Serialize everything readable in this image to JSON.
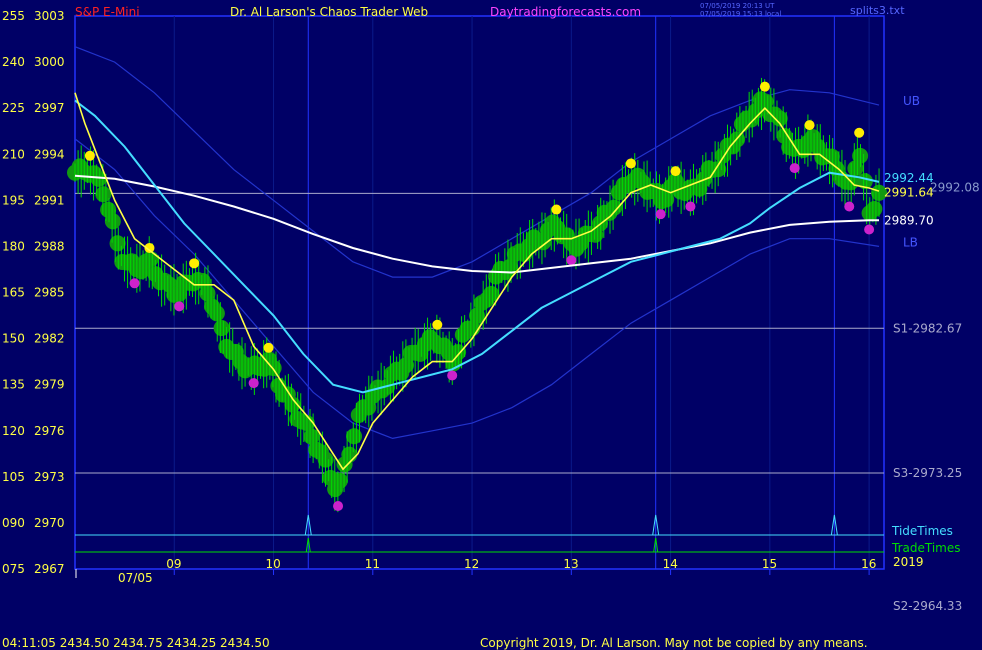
{
  "header": {
    "product": "S&P E-Mini",
    "title": "Dr. Al Larson's Chaos Trader Web",
    "site": "Daytradingforecasts.com",
    "timestamp_ut": "07/05/2019 20:13 UT",
    "timestamp_local": "07/05/2019 15:13 local",
    "data_file": "splits3.txt"
  },
  "footer": {
    "quote": "04:11:05  2434.50  2434.75  2434.25  2434.50",
    "copyright": "Copyright 2019, Dr. Al Larson. May not be copied by any means."
  },
  "colors": {
    "background": "#000066",
    "frame": "#2233ff",
    "price": "#00dd00",
    "fast_avg": "#ffff44",
    "medium_avg": "#44ddff",
    "slow_avg": "#ffffff",
    "band": "#2233cc",
    "high_marker": "#ffee00",
    "low_marker": "#cc22cc",
    "glow": "#119911",
    "level_line": "#aaaacc",
    "tide": "#44ddff",
    "trade": "#00dd00"
  },
  "chart_data": {
    "type": "line",
    "title": "S&P E-Mini",
    "date_label": "07/05",
    "year_label": "2019",
    "x_ticks": [
      "09",
      "10",
      "11",
      "12",
      "13",
      "14",
      "15",
      "16"
    ],
    "x_range_hours": [
      8.0,
      16.15
    ],
    "y_range": [
      2967,
      3003
    ],
    "y_ticks_price": [
      "3003",
      "3000",
      "2997",
      "2994",
      "2991",
      "2988",
      "2985",
      "2982",
      "2979",
      "2976",
      "2973",
      "2970",
      "2967"
    ],
    "y_ticks_scale": [
      "255",
      "240",
      "225",
      "210",
      "195",
      "180",
      "165",
      "150",
      "135",
      "120",
      "105",
      "090",
      "075"
    ],
    "levels": [
      {
        "label": "S1-2982.67",
        "value": 2982.67
      },
      {
        "label": "S3-2973.25",
        "value": 2973.25
      },
      {
        "label": "",
        "value": 2991.45
      }
    ],
    "offscale_level": "S2-2964.33",
    "band_labels": {
      "upper": "UB",
      "lower": "LB"
    },
    "end_values": [
      {
        "label": "2992.44",
        "value": 2992.44,
        "series": "medium_avg"
      },
      {
        "label": "2992.08",
        "value": 2992.08,
        "series": "medium_avg"
      },
      {
        "label": "2991.64",
        "value": 2991.64,
        "series": "fast_avg"
      },
      {
        "label": "2989.70",
        "value": 2989.7,
        "series": "slow_avg"
      }
    ],
    "timing_lines": {
      "labels": [
        "TideTimes",
        "TradeTimes"
      ],
      "hours": [
        10.35,
        13.85,
        15.65
      ]
    },
    "series": [
      {
        "name": "price",
        "x": [
          8.0,
          8.15,
          8.3,
          8.45,
          8.6,
          8.75,
          8.9,
          9.05,
          9.2,
          9.35,
          9.5,
          9.65,
          9.8,
          9.95,
          10.1,
          10.25,
          10.4,
          10.55,
          10.65,
          10.75,
          10.9,
          11.05,
          11.2,
          11.35,
          11.5,
          11.65,
          11.8,
          11.95,
          12.1,
          12.25,
          12.4,
          12.55,
          12.7,
          12.85,
          13.0,
          13.15,
          13.3,
          13.45,
          13.6,
          13.75,
          13.9,
          14.05,
          14.2,
          14.35,
          14.5,
          14.65,
          14.8,
          14.95,
          15.1,
          15.25,
          15.4,
          15.55,
          15.7,
          15.8,
          15.9,
          16.0,
          16.1
        ],
        "y": [
          2992.8,
          2993.0,
          2991.5,
          2987.5,
          2986.5,
          2987.0,
          2985.5,
          2985.0,
          2986.0,
          2985.0,
          2982.0,
          2980.5,
          2980.0,
          2980.5,
          2978.5,
          2977.0,
          2975.5,
          2973.5,
          2972.0,
          2974.5,
          2977.5,
          2978.5,
          2979.5,
          2980.5,
          2981.5,
          2982.0,
          2980.5,
          2982.5,
          2984.0,
          2986.0,
          2987.0,
          2988.0,
          2988.5,
          2989.5,
          2988.0,
          2988.5,
          2989.5,
          2991.0,
          2992.5,
          2992.0,
          2991.0,
          2992.0,
          2991.5,
          2992.5,
          2993.5,
          2995.0,
          2996.5,
          2997.5,
          2996.0,
          2994.0,
          2995.0,
          2994.0,
          2993.0,
          2991.5,
          2994.5,
          2990.0,
          2991.5
        ]
      },
      {
        "name": "fast_avg",
        "x": [
          8.0,
          8.1,
          8.25,
          8.4,
          8.6,
          8.8,
          9.0,
          9.2,
          9.4,
          9.6,
          9.8,
          10.0,
          10.2,
          10.4,
          10.6,
          10.7,
          10.85,
          11.0,
          11.2,
          11.4,
          11.6,
          11.8,
          12.0,
          12.2,
          12.4,
          12.6,
          12.8,
          13.0,
          13.2,
          13.4,
          13.6,
          13.8,
          14.0,
          14.2,
          14.4,
          14.6,
          14.8,
          14.95,
          15.1,
          15.3,
          15.5,
          15.7,
          15.85,
          16.0,
          16.1
        ],
        "y": [
          2998.0,
          2996.0,
          2993.5,
          2991.0,
          2988.5,
          2987.5,
          2986.5,
          2985.5,
          2985.5,
          2984.5,
          2981.5,
          2980.0,
          2978.0,
          2976.5,
          2974.5,
          2973.5,
          2974.5,
          2976.5,
          2978.0,
          2979.5,
          2980.5,
          2980.5,
          2982.0,
          2984.0,
          2986.0,
          2987.5,
          2988.5,
          2988.5,
          2989.0,
          2990.0,
          2991.5,
          2992.0,
          2991.5,
          2992.0,
          2992.5,
          2994.5,
          2996.0,
          2997.0,
          2996.0,
          2994.0,
          2994.0,
          2993.0,
          2992.0,
          2991.8,
          2991.6
        ]
      },
      {
        "name": "medium_avg",
        "x": [
          8.0,
          8.2,
          8.5,
          8.8,
          9.1,
          9.4,
          9.7,
          10.0,
          10.3,
          10.6,
          10.9,
          11.2,
          11.5,
          11.8,
          12.1,
          12.4,
          12.7,
          13.0,
          13.3,
          13.6,
          13.9,
          14.2,
          14.5,
          14.8,
          15.0,
          15.3,
          15.6,
          15.9,
          16.1
        ],
        "y": [
          2997.5,
          2996.5,
          2994.5,
          2992.0,
          2989.5,
          2987.5,
          2985.5,
          2983.5,
          2981.0,
          2979.0,
          2978.5,
          2979.0,
          2979.5,
          2980.0,
          2981.0,
          2982.5,
          2984.0,
          2985.0,
          2986.0,
          2987.0,
          2987.5,
          2988.0,
          2988.5,
          2989.5,
          2990.5,
          2991.8,
          2992.8,
          2992.5,
          2992.2
        ]
      },
      {
        "name": "slow_avg",
        "x": [
          8.0,
          8.4,
          8.8,
          9.2,
          9.6,
          10.0,
          10.4,
          10.8,
          11.2,
          11.6,
          12.0,
          12.4,
          12.8,
          13.2,
          13.6,
          14.0,
          14.4,
          14.8,
          15.2,
          15.6,
          16.0,
          16.1
        ],
        "y": [
          2992.6,
          2992.4,
          2991.9,
          2991.3,
          2990.6,
          2989.8,
          2988.8,
          2987.9,
          2987.2,
          2986.7,
          2986.4,
          2986.3,
          2986.6,
          2986.9,
          2987.2,
          2987.7,
          2988.2,
          2988.9,
          2989.4,
          2989.6,
          2989.7,
          2989.7
        ]
      },
      {
        "name": "upper_band",
        "x": [
          8.0,
          8.4,
          8.8,
          9.2,
          9.6,
          10.0,
          10.4,
          10.8,
          11.2,
          11.6,
          12.0,
          12.4,
          12.8,
          13.2,
          13.6,
          14.0,
          14.4,
          14.8,
          15.2,
          15.6,
          16.1
        ],
        "y": [
          3001.0,
          3000.0,
          2998.0,
          2995.5,
          2993.0,
          2991.0,
          2989.0,
          2987.0,
          2986.0,
          2986.0,
          2987.0,
          2988.5,
          2990.0,
          2991.5,
          2993.5,
          2995.0,
          2996.5,
          2997.5,
          2998.2,
          2998.0,
          2997.2
        ]
      },
      {
        "name": "lower_band",
        "x": [
          8.0,
          8.4,
          8.8,
          9.2,
          9.6,
          10.0,
          10.4,
          10.8,
          11.2,
          11.6,
          12.0,
          12.4,
          12.8,
          13.2,
          13.6,
          14.0,
          14.4,
          14.8,
          15.2,
          15.6,
          16.1
        ],
        "y": [
          2995.0,
          2993.0,
          2990.0,
          2987.5,
          2984.5,
          2981.5,
          2978.5,
          2976.5,
          2975.5,
          2976.0,
          2976.5,
          2977.5,
          2979.0,
          2981.0,
          2983.0,
          2984.5,
          2986.0,
          2987.5,
          2988.5,
          2988.5,
          2988.0
        ]
      }
    ]
  }
}
